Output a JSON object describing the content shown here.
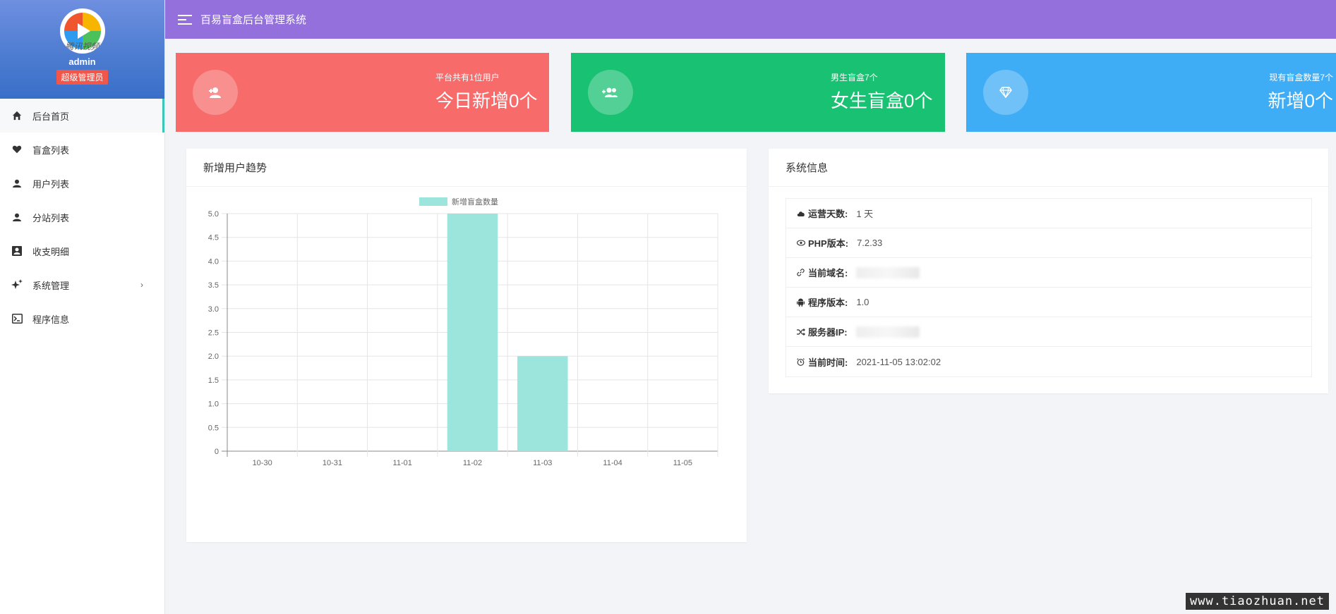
{
  "sidebar": {
    "avatar_watermark": "腾讯视频",
    "admin_name": "admin",
    "role": "超级管理员",
    "menu": [
      {
        "label": "后台首页",
        "icon": "home-icon"
      },
      {
        "label": "盲盒列表",
        "icon": "heart-icon"
      },
      {
        "label": "用户列表",
        "icon": "user-icon"
      },
      {
        "label": "分站列表",
        "icon": "user-icon"
      },
      {
        "label": "收支明细",
        "icon": "contact-card-icon"
      },
      {
        "label": "系统管理",
        "icon": "sparkle-icon",
        "arrow": "›"
      },
      {
        "label": "程序信息",
        "icon": "terminal-icon"
      }
    ]
  },
  "header": {
    "title": "百易盲盒后台管理系统"
  },
  "stats": [
    {
      "small": "平台共有1位用户",
      "big": "今日新增0个",
      "color": "#f76b6b",
      "icon": "user-plus-icon"
    },
    {
      "small": "男生盲盒7个",
      "big": "女生盲盒0个",
      "color": "#19c172",
      "icon": "users-plus-icon"
    },
    {
      "small": "现有盲盒数量7个",
      "big": "新增0个",
      "color": "#3fadf5",
      "icon": "diamond-icon"
    }
  ],
  "chart_panel": {
    "title": "新增用户趋势"
  },
  "chart_data": {
    "type": "bar",
    "categories": [
      "10-30",
      "10-31",
      "11-01",
      "11-02",
      "11-03",
      "11-04",
      "11-05"
    ],
    "series": [
      {
        "name": "新增盲盒数量",
        "values": [
          0,
          0,
          0,
          5,
          2,
          0,
          0
        ]
      }
    ],
    "ylim": [
      0,
      5
    ],
    "yticks": [
      "0",
      "0.5",
      "1.0",
      "1.5",
      "2.0",
      "2.5",
      "3.0",
      "3.5",
      "4.0",
      "4.5",
      "5.0"
    ],
    "grid": true,
    "legend": "top-center",
    "color": "#9ce5dd"
  },
  "info_panel": {
    "title": "系统信息",
    "rows": [
      {
        "label": "运营天数:",
        "value": "1 天",
        "icon": "cloud-icon"
      },
      {
        "label": "PHP版本:",
        "value": "7.2.33",
        "icon": "eye-icon"
      },
      {
        "label": "当前域名:",
        "value": "",
        "icon": "link-icon"
      },
      {
        "label": "程序版本:",
        "value": "1.0",
        "icon": "android-icon"
      },
      {
        "label": "服务器IP:",
        "value": "",
        "icon": "shuffle-icon"
      },
      {
        "label": "当前时间:",
        "value": "2021-11-05 13:02:02",
        "icon": "alarm-icon"
      }
    ]
  },
  "watermark": "www.tiaozhuan.net"
}
